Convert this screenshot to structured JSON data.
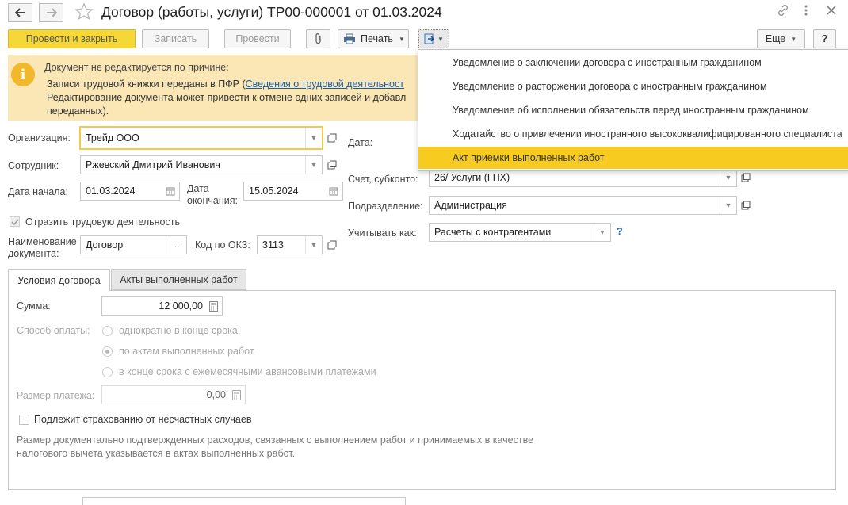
{
  "window": {
    "title": "Договор (работы, услуги) ТР00-000001 от 01.03.2024"
  },
  "toolbar": {
    "post_close": "Провести и закрыть",
    "save": "Записать",
    "post": "Провести",
    "print": "Печать",
    "more": "Еще",
    "help": "?"
  },
  "notice": {
    "heading": "Документ не редактируется по причине:",
    "line1_prefix": "Записи трудовой книжки переданы в ПФР (",
    "line1_link": "Сведения о трудовой деятельност",
    "line2": "Редактирование документа может привести к отмене одних записей и добавл",
    "line3": "переданных)."
  },
  "menu": {
    "items": [
      "Уведомление о заключении договора с иностранным гражданином",
      "Уведомление о расторжении договора с иностранным гражданином",
      "Уведомление об исполнении обязательств перед иностранным гражданином",
      "Ходатайство о привлечении иностранного высококвалифицированного специалиста",
      "Акт приемки выполненных работ"
    ],
    "selected_index": 4
  },
  "form": {
    "org_label": "Организация:",
    "org_value": "Трейд ООО",
    "employee_label": "Сотрудник:",
    "employee_value": "Ржевский Дмитрий Иванович",
    "start_label": "Дата начала:",
    "start_value": "01.03.2024",
    "end_label_1": "Дата",
    "end_label_2": "окончания:",
    "end_value": "15.05.2024",
    "reflect_label": "Отразить трудовую деятельность",
    "reflect_checked": true,
    "docname_label_1": "Наименование",
    "docname_label_2": "документа:",
    "docname_value": "Договор",
    "okz_label": "Код по ОКЗ:",
    "okz_value": "3113",
    "date_label": "Дата:",
    "account_label": "Счет, субконто:",
    "account_value": "26/ Услуги (ГПХ)",
    "division_label": "Подразделение:",
    "division_value": "Администрация",
    "account_as_label": "Учитывать как:",
    "account_as_value": "Расчеты с контрагентами",
    "account_as_help": "?"
  },
  "tabs": [
    {
      "label": "Условия договора",
      "active": true
    },
    {
      "label": "Акты выполненных работ",
      "active": false
    }
  ],
  "conditions": {
    "sum_label": "Сумма:",
    "sum_value": "12 000,00",
    "payment_label": "Способ оплаты:",
    "payment_options": [
      "однократно в конце срока",
      "по актам выполненных работ",
      "в конце срока с ежемесячными авансовыми платежами"
    ],
    "payment_selected": 1,
    "payment_size_label": "Размер платежа:",
    "payment_size_value": "0,00",
    "insurance_label": "Подлежит страхованию от несчастных случаев",
    "insurance_checked": false,
    "note_line1": "Размер документально подтвержденных расходов, связанных с выполнением работ и принимаемых в качестве",
    "note_line2": "налогового вычета указывается в актах выполненных работ."
  },
  "colors": {
    "accent": "#f5d838",
    "notice_bg": "#fbe7b6",
    "menu_highlight": "#f7cb1f",
    "link": "#1a5da6",
    "info_icon": "#f2b82c"
  }
}
